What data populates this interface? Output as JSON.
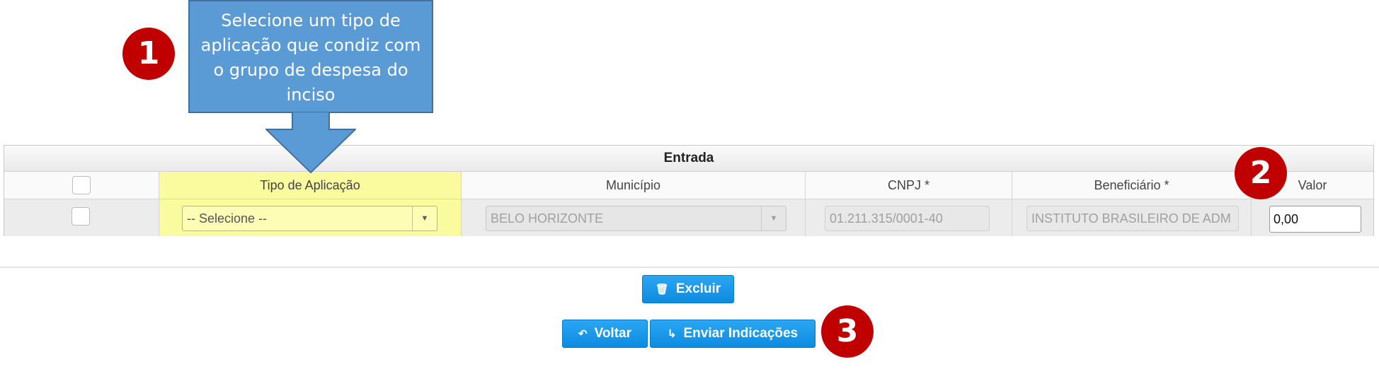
{
  "callout": {
    "text": "Selecione um tipo de aplicação que condiz com o grupo de despesa do inciso"
  },
  "steps": [
    "1",
    "2",
    "3"
  ],
  "grid": {
    "title": "Entrada",
    "columns": [
      "Tipo de Aplicação",
      "Município",
      "CNPJ *",
      "Beneficiário *",
      "Valor"
    ],
    "row": {
      "tipo_aplicacao": "-- Selecione --",
      "municipio": "BELO HORIZONTE",
      "cnpj": "01.211.315/0001-40",
      "beneficiario": "INSTITUTO BRASILEIRO DE ADM",
      "valor": "0,00"
    }
  },
  "actions": {
    "excluir": "Excluir",
    "voltar": "Voltar",
    "enviar": "Enviar Indicações"
  },
  "icons": [
    "trash-icon",
    "undo-icon",
    "forward-icon",
    "chevron-down-icon"
  ],
  "colors": {
    "callout": "#5b9bd5",
    "badge": "#c00000",
    "highlight": "#fafa9e",
    "button": "#1a9bea"
  }
}
